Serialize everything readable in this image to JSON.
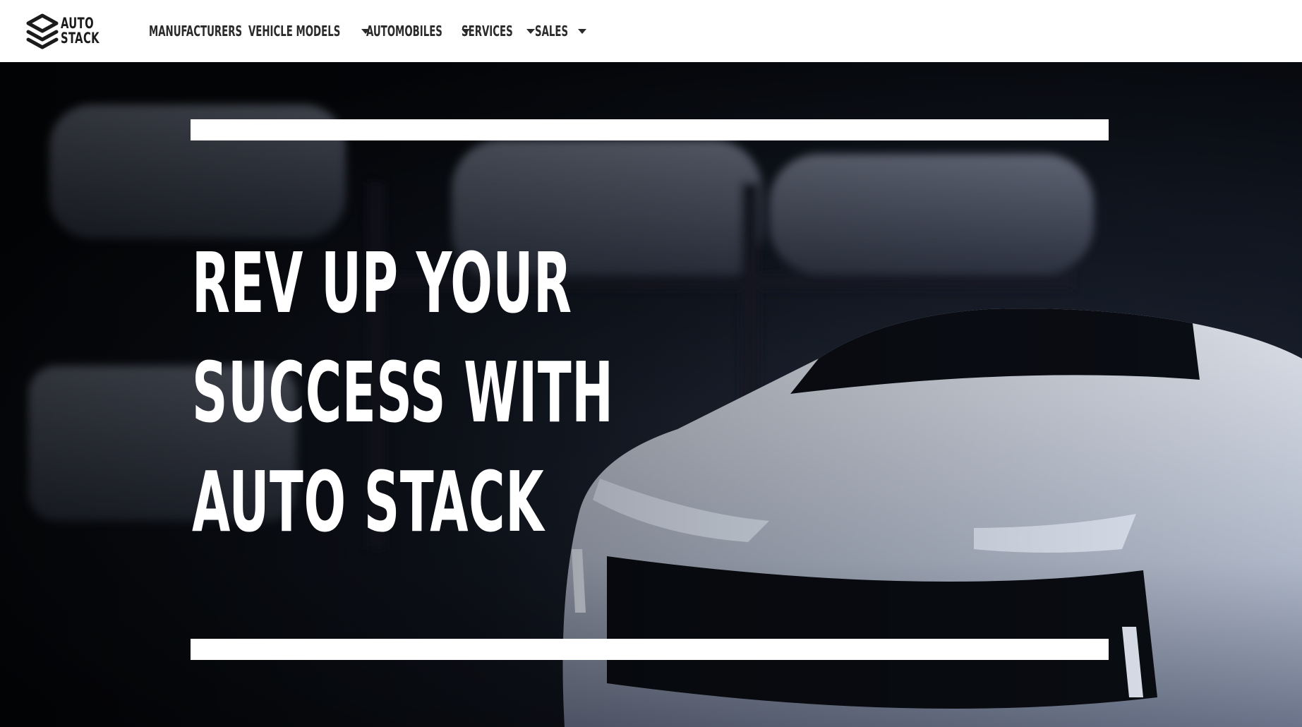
{
  "brand": {
    "line1": "AUTO",
    "line2": "STACK"
  },
  "nav": {
    "items": [
      {
        "label": "MANUFACTURERS",
        "has_dropdown": false
      },
      {
        "label": "VEHICLE MODELS",
        "has_dropdown": true
      },
      {
        "label": "AUTOMOBILES",
        "has_dropdown": true
      },
      {
        "label": "SERVICES",
        "has_dropdown": true
      },
      {
        "label": "SALES",
        "has_dropdown": true
      }
    ]
  },
  "hero": {
    "headline_lines": [
      "REV UP YOUR",
      "SUCCESS WITH",
      "AUTO STACK"
    ]
  },
  "colors": {
    "navbar_bg": "#ffffff",
    "nav_text": "#2a2a2a",
    "hero_text": "#ffffff",
    "hero_bar": "#ffffff"
  }
}
